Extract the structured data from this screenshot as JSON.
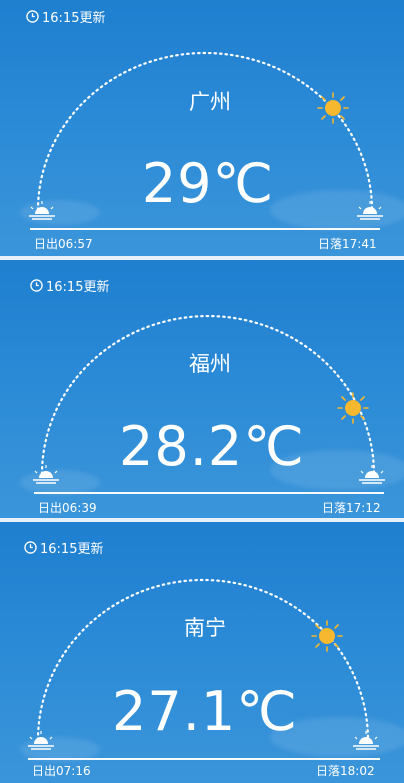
{
  "panels": [
    {
      "updated": "16:15更新",
      "city": "广州",
      "temperature": "29℃",
      "sunrise": "日出06:57",
      "sunset": "日落17:41"
    },
    {
      "updated": "16:15更新",
      "city": "福州",
      "temperature": "28.2℃",
      "sunrise": "日出06:39",
      "sunset": "日落17:12"
    },
    {
      "updated": "16:15更新",
      "city": "南宁",
      "temperature": "27.1℃",
      "sunrise": "日出07:16",
      "sunset": "日落18:02"
    }
  ],
  "colors": {
    "background": "#2a8ad6",
    "sun": "#f5b82e",
    "text": "#ffffff"
  },
  "icons": {
    "clock": "clock-icon",
    "sun": "sun-icon",
    "sunrise": "sunrise-icon",
    "sunset": "sunset-icon"
  }
}
